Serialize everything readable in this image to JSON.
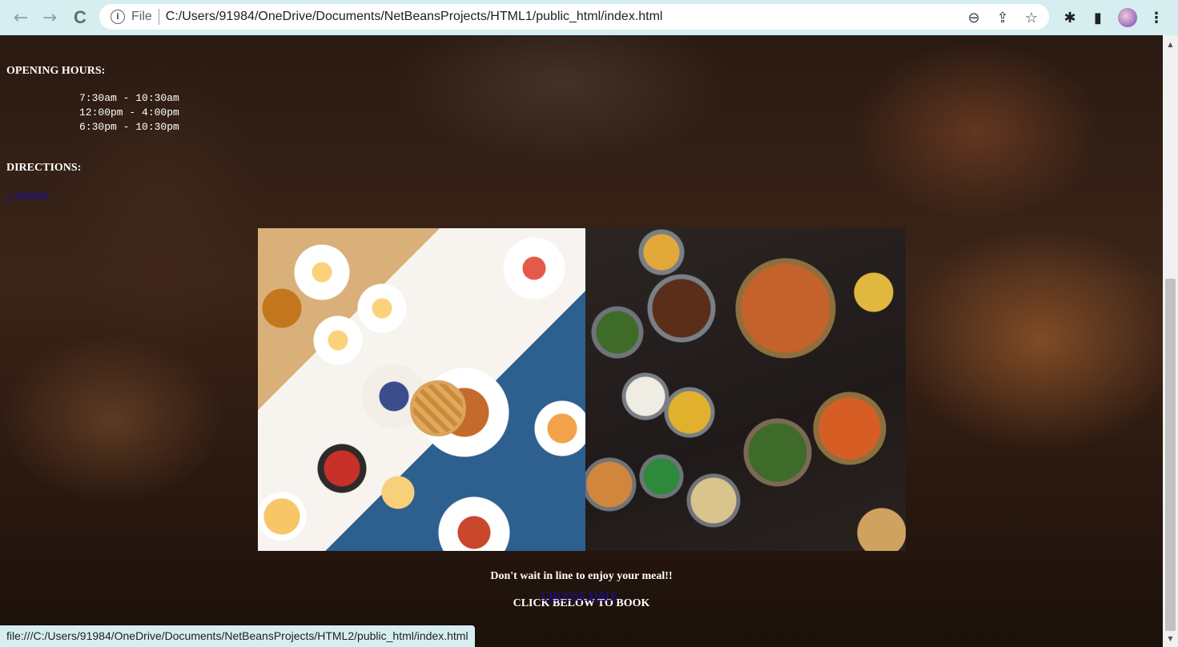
{
  "browser": {
    "back_icon": "←",
    "forward_icon": "→",
    "reload_icon": "C",
    "scheme_label": "File",
    "url": "C:/Users/91984/OneDrive/Documents/NetBeansProjects/HTML1/public_html/index.html",
    "zoom_icon": "⊖",
    "share_icon": "⇪",
    "star_icon": "☆",
    "extensions_icon": "✱",
    "sidepanel_icon": "▮",
    "menu_icon": "⋮",
    "status_url": "file:///C:/Users/91984/OneDrive/Documents/NetBeansProjects/HTML2/public_html/index.html"
  },
  "page": {
    "opening_hours_heading": "OPENING HOURS:",
    "hours": [
      "7:30am - 10:30am",
      "12:00pm - 4:00pm",
      "6:30pm - 10:30pm"
    ],
    "directions_heading": "DIRECTIONS:",
    "location_link": "> location",
    "tagline_1": "Don't wait in line to enjoy your meal!!",
    "tagline_2": "CLICK BELOW TO BOOK",
    "choose_date_link": "CHOOSE DATE"
  },
  "scrollbar": {
    "up_icon": "▲",
    "down_icon": "▼"
  }
}
